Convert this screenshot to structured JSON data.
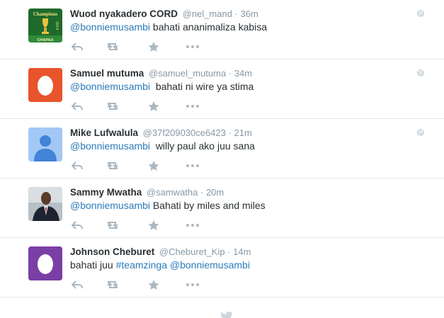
{
  "tweets": [
    {
      "fullname": "Wuod nyakadero CORD",
      "username": "@nel_mand",
      "time": "36m",
      "parts": [
        {
          "t": "@bonniemusambi",
          "k": "mention"
        },
        {
          "t": " bahati ananimaliza kabisa",
          "k": "text"
        }
      ],
      "avatar": "champions-logo",
      "avatar_text": [
        "Champions",
        "2014",
        "CHAPAA"
      ],
      "show_globe": true
    },
    {
      "fullname": "Samuel mutuma",
      "username": "@samuel_mutuma",
      "time": "34m",
      "parts": [
        {
          "t": "@bonniemusambi",
          "k": "mention"
        },
        {
          "t": "  bahati ni wire ya stima",
          "k": "text"
        }
      ],
      "avatar": "egg-orange",
      "show_globe": true
    },
    {
      "fullname": "Mike Lufwalula",
      "username": "@37f209030ce6423",
      "time": "21m",
      "parts": [
        {
          "t": "@bonniemusambi",
          "k": "mention"
        },
        {
          "t": "  willy paul ako juu sana",
          "k": "text"
        }
      ],
      "avatar": "default-person",
      "show_globe": true
    },
    {
      "fullname": "Sammy Mwatha",
      "username": "@samwatha",
      "time": "20m",
      "parts": [
        {
          "t": "@bonniemusambi",
          "k": "mention"
        },
        {
          "t": " Bahati by miles and miles",
          "k": "text"
        }
      ],
      "avatar": "photo-man-suit",
      "show_globe": false
    },
    {
      "fullname": "Johnson Cheburet",
      "username": "@Cheburet_Kip",
      "time": "14m",
      "parts": [
        {
          "t": "bahati juu ",
          "k": "text"
        },
        {
          "t": "#teamzinga",
          "k": "hashtag"
        },
        {
          "t": " ",
          "k": "text"
        },
        {
          "t": "@bonniemusambi",
          "k": "mention"
        }
      ],
      "avatar": "egg-purple",
      "show_globe": false
    }
  ],
  "separator": " · ",
  "footer": {
    "icon": "twitter-bird-icon"
  },
  "colors": {
    "link": "#2b7bb9",
    "muted": "#8899a6",
    "action_icon": "#aab8c2",
    "egg_orange": "#e8542b",
    "egg_purple": "#7a3fa4",
    "default_avatar_bg": "#a3c8f5",
    "default_avatar_fg": "#4183d7"
  }
}
